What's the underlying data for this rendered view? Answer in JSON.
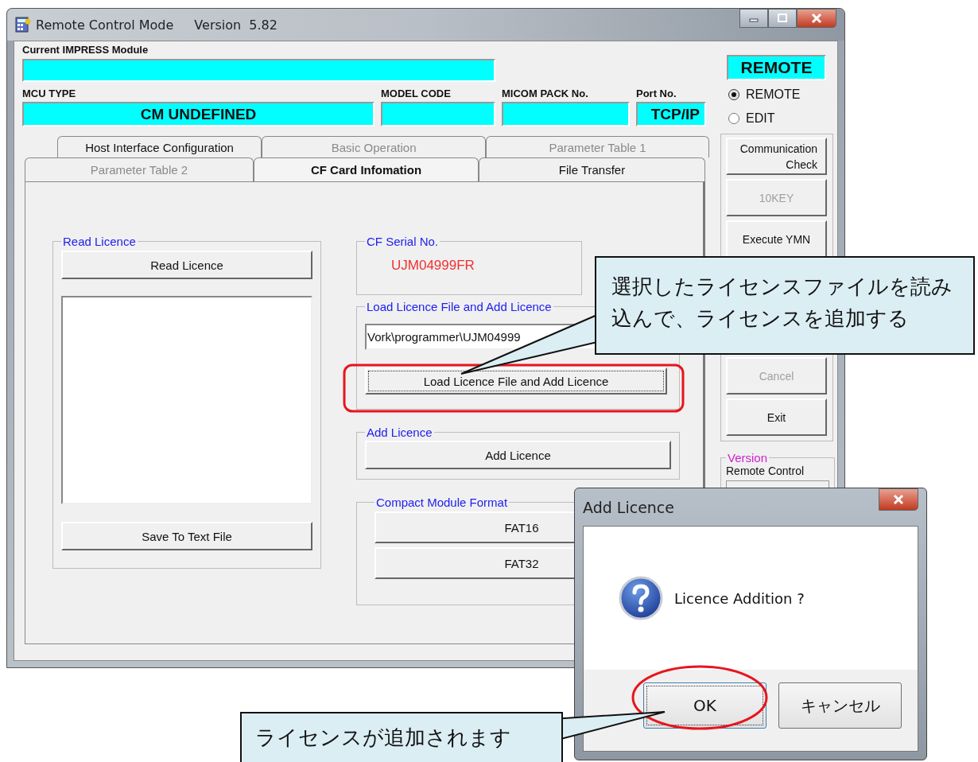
{
  "window": {
    "title": "Remote Control Mode",
    "version": "Version  5.82"
  },
  "current_module": {
    "label": "Current IMPRESS Module"
  },
  "info_fields": [
    {
      "label": "MCU TYPE",
      "value": "CM UNDEFINED"
    },
    {
      "label": "MODEL CODE"
    },
    {
      "label": "MICOM PACK No."
    },
    {
      "label": "Port No.",
      "value": "TCP/IP"
    }
  ],
  "tab_rows": [
    {
      "tabs": [
        {
          "label": "Host Interface Configuration",
          "selected": false,
          "disabled": false
        },
        {
          "label": "Basic Operation",
          "selected": false,
          "disabled": true
        },
        {
          "label": "Parameter Table 1",
          "selected": false,
          "disabled": true
        }
      ]
    },
    {
      "tabs": [
        {
          "label": "Parameter Table 2",
          "selected": false,
          "disabled": true
        },
        {
          "label": "CF Card Infomation",
          "selected": true,
          "disabled": false
        },
        {
          "label": "File Transfer",
          "selected": false,
          "disabled": false
        }
      ]
    }
  ],
  "read_licence": {
    "title": "Read Licence",
    "button": "Read Licence",
    "save_button": "Save To Text File"
  },
  "cf_serial": {
    "title": "CF Serial No.",
    "value": "UJM04999FR"
  },
  "load_licence": {
    "title": "Load Licence File and Add Licence",
    "path": "Vork\\programmer\\UJM04999",
    "button": "Load Licence File and Add Licence"
  },
  "add_licence": {
    "title": "Add Licence",
    "button": "Add Licence"
  },
  "format": {
    "title": "Compact Module Format",
    "buttons": [
      "FAT16",
      "FAT32"
    ]
  },
  "mode": {
    "indicator": "REMOTE",
    "options": [
      {
        "label": "REMOTE",
        "selected": true
      },
      {
        "label": "EDIT",
        "selected": false
      }
    ]
  },
  "side_buttons": [
    {
      "label": "Communication Check",
      "disabled": false
    },
    {
      "label": "10KEY",
      "disabled": true
    },
    {
      "label": "Execute YMN",
      "disabled": false
    },
    {
      "label": "Cancel",
      "disabled": true
    },
    {
      "label": "Exit",
      "disabled": false
    }
  ],
  "version_group": {
    "title": "Version",
    "label": "Remote Control"
  },
  "dialog": {
    "title": "Add Licence",
    "message": "Licence Addition ?",
    "buttons": [
      {
        "label": "OK",
        "selected": true
      },
      {
        "label": "キャンセル",
        "selected": false
      }
    ]
  },
  "callouts": [
    {
      "text": "選択したライセンスファイルを読み込んで、ライセンスを追加する"
    },
    {
      "text": "ライセンスが追加されます"
    }
  ]
}
